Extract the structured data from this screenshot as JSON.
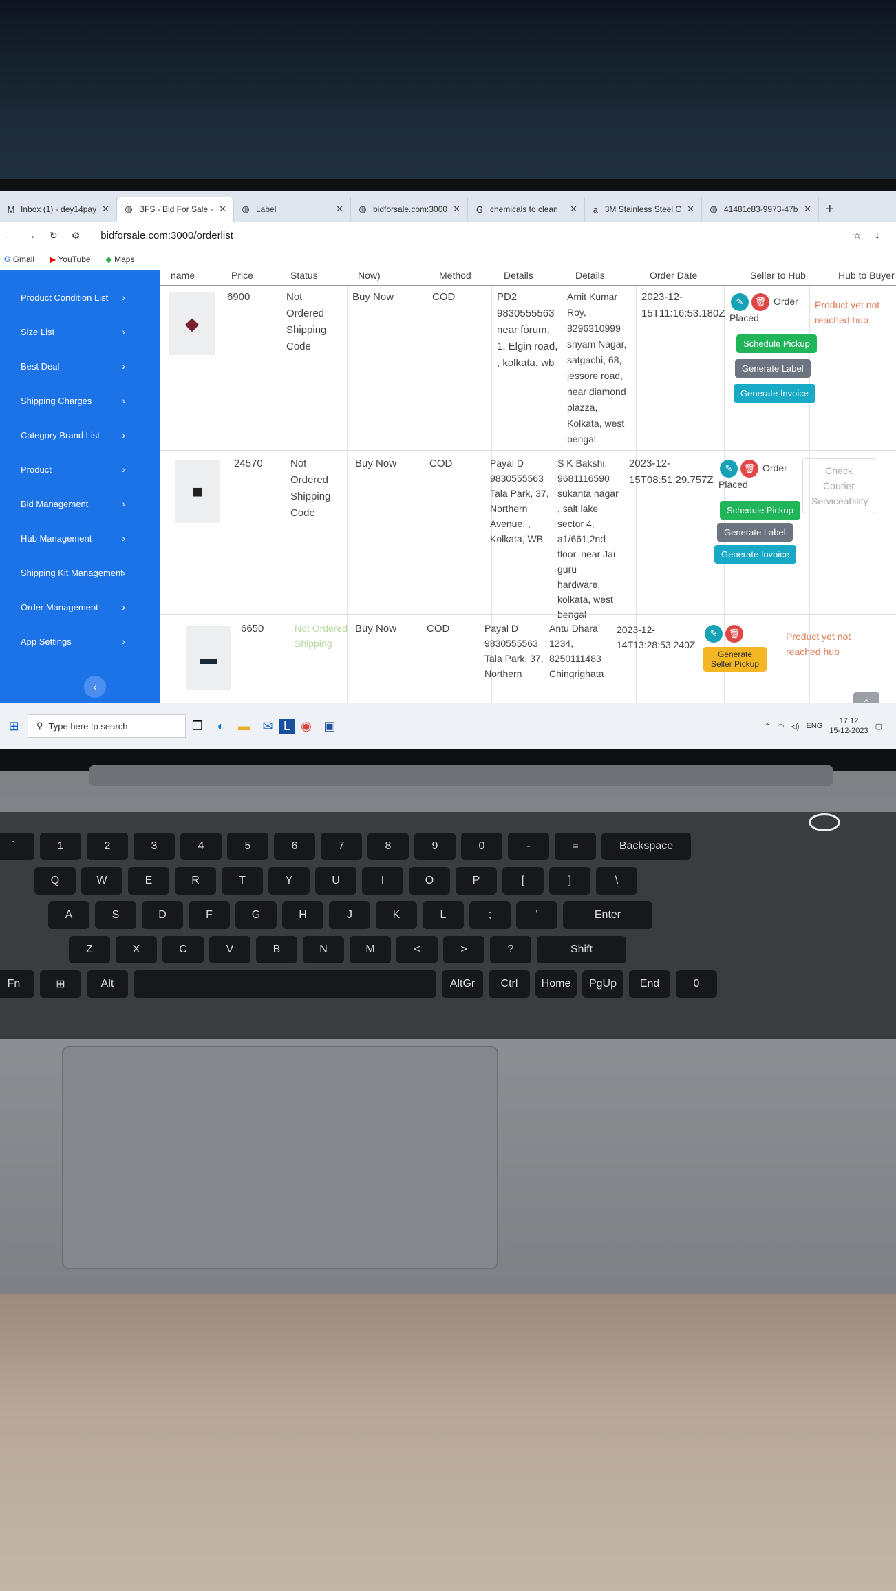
{
  "tabs": [
    {
      "icon": "gmail-icon",
      "glyph": "M",
      "title": "Inbox (1) - dey14pay"
    },
    {
      "icon": "globe-icon",
      "glyph": "◍",
      "title": "BFS - Bid For Sale - "
    },
    {
      "icon": "globe-icon",
      "glyph": "◍",
      "title": "Label"
    },
    {
      "icon": "globe-icon",
      "glyph": "◍",
      "title": "bidforsale.com:3000"
    },
    {
      "icon": "google-icon",
      "glyph": "G",
      "title": "chemicals to clean "
    },
    {
      "icon": "amazon-icon",
      "glyph": "a",
      "title": "3M Stainless Steel C"
    },
    {
      "icon": "globe-icon",
      "glyph": "◍",
      "title": "41481c83-9973-47b"
    }
  ],
  "url": "bidforsale.com:3000/orderlist",
  "bookmarks": [
    "Gmail",
    "YouTube",
    "Maps"
  ],
  "sidebar": [
    "Product Condition List",
    "Size List",
    "Best Deal",
    "Shipping Charges",
    "Category Brand List",
    "Product",
    "Bid Management",
    "Hub Management",
    "Shipping Kit Management",
    "Order Management",
    "App Settings"
  ],
  "headers": [
    "name",
    "Price",
    "Status",
    "Now)",
    "Method",
    "Details",
    "Details",
    "Order Date",
    "Seller to Hub",
    "Hub to Buyer"
  ],
  "rows": [
    {
      "price": "6900",
      "status": "Not Ordered Shipping Code",
      "type": "Buy Now",
      "method": "COD",
      "buyer": "PD2 9830555563 near forum, 1, Elgin road, , kolkata, wb",
      "seller": "Amit Kumar Roy, 8296310999 shyam Nagar, satgachi, 68, jessore road, near diamond plazza, Kolkata, west bengal",
      "date": "2023-12-15T11:16:53.180Z",
      "seller_status": "Order Placed",
      "hub": "Product yet not reached hub"
    },
    {
      "price": "24570",
      "status": "Not Ordered Shipping Code",
      "type": "Buy Now",
      "method": "COD",
      "buyer": "Payal D 9830555563 Tala Park, 37, Northern Avenue, , Kolkata, WB",
      "seller": "S K Bakshi, 9681116590 sukanta nagar , salt lake sector 4, a1/661,2nd floor, near Jai guru hardware, kolkata, west bengal",
      "date": "2023-12-15T08:51:29.757Z",
      "seller_status": "Order Placed",
      "hub": "Check Courier Serviceability"
    },
    {
      "price": "6650",
      "status": "Not Ordered Shipping",
      "type": "Buy Now",
      "method": "COD",
      "buyer": "Payal D 9830555563 Tala Park, 37, Northern",
      "seller": "Antu Dhara 1234, 8250111483 Chingrighata",
      "date": "2023-12-14T13:28:53.240Z",
      "seller_status": "",
      "hub": "Product yet not reached hub"
    }
  ],
  "buttons": {
    "schedule": "Schedule Pickup",
    "label": "Generate Label",
    "invoice": "Generate Invoice",
    "seller_pickup": "Generate Seller Pickup"
  },
  "taskbar": {
    "search_placeholder": "Type here to search",
    "lang": "ENG",
    "time": "17:12",
    "date": "15-12-2023"
  },
  "keyboard": {
    "row1": [
      "`",
      "1",
      "2",
      "3",
      "4",
      "5",
      "6",
      "7",
      "8",
      "9",
      "0",
      "-",
      "=",
      "Backspace"
    ],
    "row2": [
      "Q",
      "W",
      "E",
      "R",
      "T",
      "Y",
      "U",
      "I",
      "O",
      "P",
      "[",
      "]",
      "\\"
    ],
    "row3": [
      "A",
      "S",
      "D",
      "F",
      "G",
      "H",
      "J",
      "K",
      "L",
      ";",
      "'",
      "Enter"
    ],
    "row4": [
      "Z",
      "X",
      "C",
      "V",
      "B",
      "N",
      "M",
      "<",
      ">",
      "?",
      "Shift"
    ],
    "row5": [
      "Fn",
      "⊞",
      "Alt",
      "",
      "AltGr",
      "Ctrl",
      "Home",
      "PgUp",
      "End",
      "0"
    ]
  },
  "colors": {
    "sidebar": "#1c73e8",
    "green": "#21b55a",
    "gray": "#6b7480",
    "cyan": "#17a9c6",
    "yellow": "#f4b622",
    "hub_text": "#e07b55"
  }
}
